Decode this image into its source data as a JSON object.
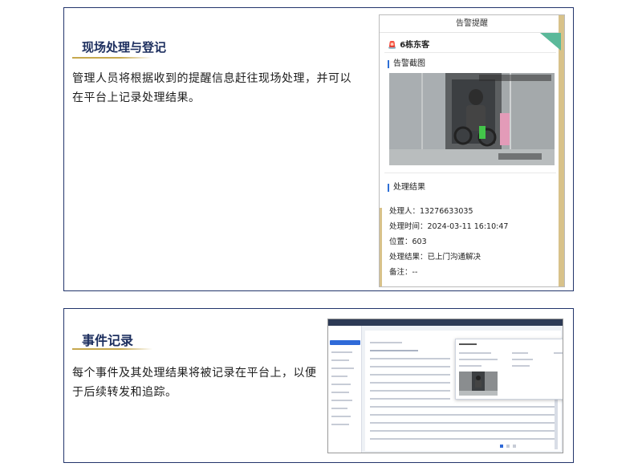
{
  "section1": {
    "title": "现场处理与登记",
    "description": "管理人员将根据收到的提醒信息赶往现场处理，并可以在平台上记录处理结果。",
    "phone": {
      "header": "告警提醒",
      "location": "6栋东客",
      "screenshot_label": "告警截图",
      "result_label": "处理结果",
      "fields": [
        {
          "label": "处理人：",
          "value": "13276633035"
        },
        {
          "label": "处理时间：",
          "value": "2024-03-11 16:10:47"
        },
        {
          "label": "位置：",
          "value": "603"
        },
        {
          "label": "处理结果：",
          "value": "已上门沟通解决"
        },
        {
          "label": "备注：",
          "value": "--"
        }
      ]
    }
  },
  "section2": {
    "title": "事件记录",
    "description": "每个事件及其处理结果将被记录在平台上，以便于后续转发和追踪。"
  },
  "colors": {
    "navy": "#1c2e5e",
    "gold": "#c6a84e",
    "accent_blue": "#2f6ad8",
    "alarm_red": "#e33333",
    "ribbon_green": "#5bb99a"
  }
}
